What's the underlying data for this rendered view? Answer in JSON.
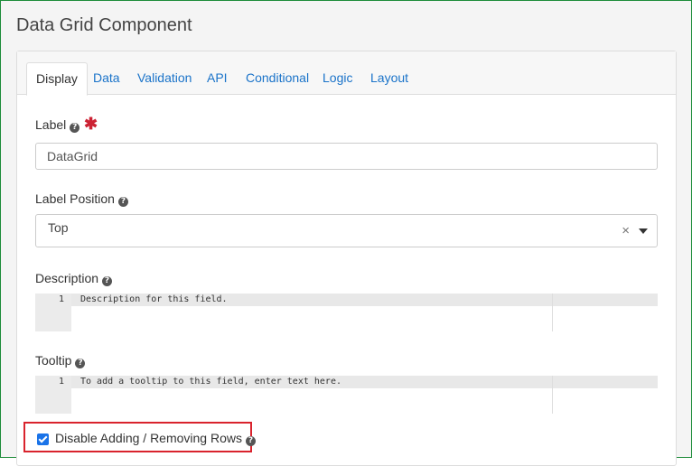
{
  "header": {
    "title": "Data Grid Component"
  },
  "tabs": [
    {
      "label": "Display",
      "active": true
    },
    {
      "label": "Data"
    },
    {
      "label": "Validation"
    },
    {
      "label": "API"
    },
    {
      "label": "Conditional"
    },
    {
      "label": "Logic"
    },
    {
      "label": "Layout"
    }
  ],
  "fields": {
    "label": {
      "label": "Label",
      "value": "DataGrid",
      "required_mark": "✱"
    },
    "label_position": {
      "label": "Label Position",
      "value": "Top",
      "clear": "×"
    },
    "description": {
      "label": "Description",
      "line_number": "1",
      "placeholder": "Description for this field."
    },
    "tooltip": {
      "label": "Tooltip",
      "line_number": "1",
      "placeholder": "To add a tooltip to this field, enter text here."
    },
    "disable_rows": {
      "label": "Disable Adding / Removing Rows",
      "checked": true
    }
  },
  "icons": {
    "help": "?"
  },
  "colors": {
    "accent": "#1a73c9",
    "highlight_border": "#d9232d",
    "frame_border": "#1e8c3a",
    "required": "#cc2233"
  }
}
